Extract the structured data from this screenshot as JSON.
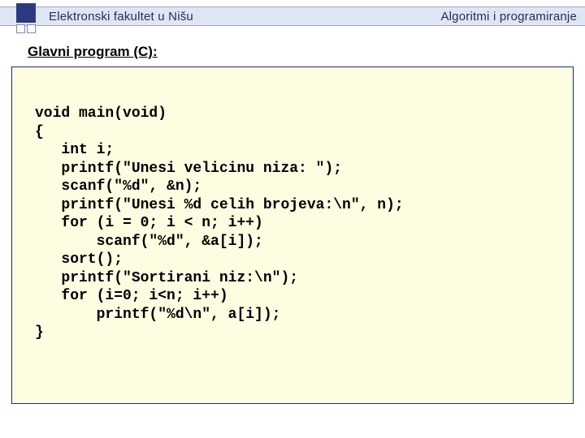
{
  "header": {
    "left": "Elektronski fakultet u Nišu",
    "right": "Algoritmi i programiranje"
  },
  "section_title": "Glavni program (C):",
  "code": "void main(void)\n{\n   int i;\n   printf(\"Unesi velicinu niza: \");\n   scanf(\"%d\", &n);\n   printf(\"Unesi %d celih brojeva:\\n\", n);\n   for (i = 0; i < n; i++)\n       scanf(\"%d\", &a[i]);\n   sort();\n   printf(\"Sortirani niz:\\n\");\n   for (i=0; i<n; i++)\n       printf(\"%d\\n\", a[i]);\n}"
}
